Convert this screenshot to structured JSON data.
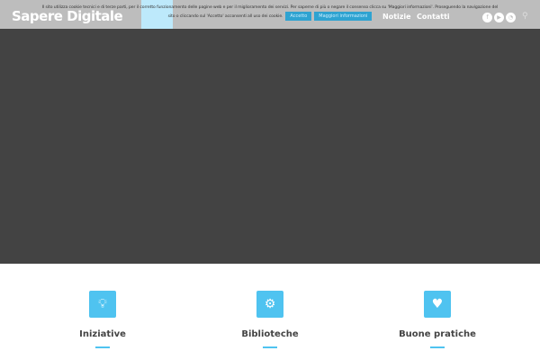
{
  "header": {
    "logo": "Sapere Digitale",
    "nav": [
      "Notizie",
      "Contatti"
    ],
    "social": [
      "facebook-icon",
      "youtube-icon",
      "rss-icon"
    ]
  },
  "cookie": {
    "line1": "Il sito utilizza cookie tecnici e di terze parti, per il corretto funzionamento delle pagine web e per il miglioramento dei servizi. Per saperne di più o negare il consenso clicca su 'Maggiori informazioni'. Proseguendo la navigazione del",
    "line2": "sito o cliccando sul 'Accetto' acconsenti all uso dei cookie.",
    "accept": "Accetto",
    "more": "Maggiori informazioni"
  },
  "features": [
    {
      "title": "Iniziative",
      "icon": "lightbulb-icon"
    },
    {
      "title": "Biblioteche",
      "icon": "gears-icon"
    },
    {
      "title": "Buone pratiche",
      "icon": "plant-icon"
    }
  ],
  "colors": {
    "accent": "#4fc3f0",
    "hero": "#434343"
  }
}
